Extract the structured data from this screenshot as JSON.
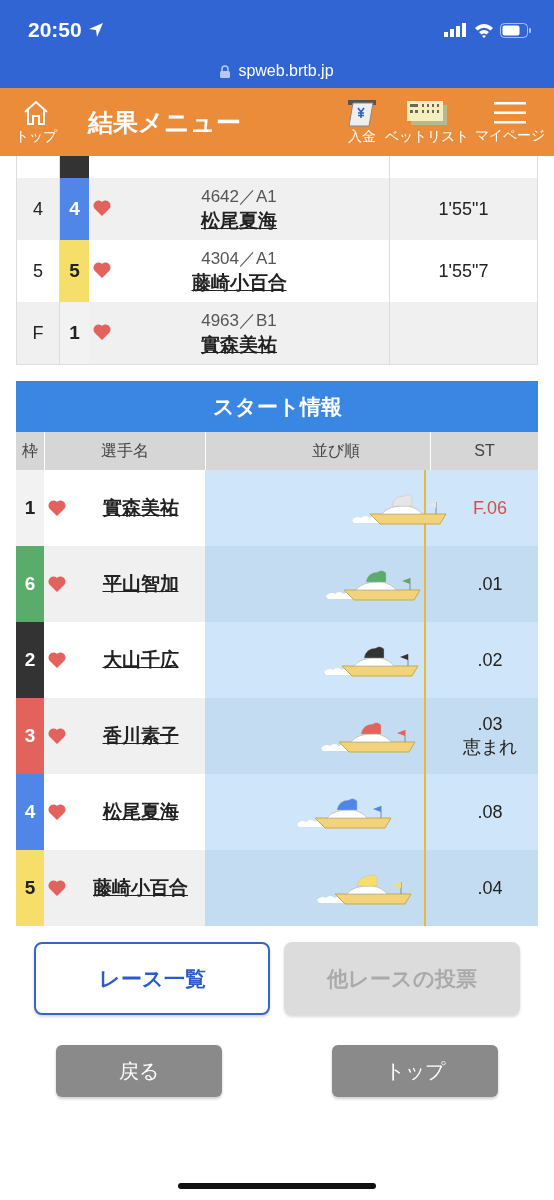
{
  "status_bar": {
    "time": "20:50",
    "url": "spweb.brtb.jp"
  },
  "header": {
    "home_label": "トップ",
    "title": "結果メニュー",
    "actions": [
      {
        "kind": "deposit",
        "label": "入金"
      },
      {
        "kind": "betlist",
        "label": "ベットリスト"
      },
      {
        "kind": "menu",
        "label": "マイページ"
      }
    ]
  },
  "results": {
    "partial_row": {
      "color": "#333333"
    },
    "rows": [
      {
        "rank": "4",
        "frame": "4",
        "color": "#4f86e8",
        "favorite": true,
        "id_class": "4642／A1",
        "name": "松尾夏海",
        "time": "1'55\"1"
      },
      {
        "rank": "5",
        "frame": "5",
        "color": "#f6de6a",
        "favorite": true,
        "id_class": "4304／A1",
        "name": "藤崎小百合",
        "time": "1'55\"7"
      },
      {
        "rank": "F",
        "frame": "1",
        "color": "#f2f2f2",
        "favorite": true,
        "id_class": "4963／B1",
        "name": "實森美祐"
      }
    ]
  },
  "start_info": {
    "title": "スタート情報",
    "columns": [
      "枠",
      "選手名",
      "並び順",
      "ST"
    ],
    "rows": [
      {
        "frame": "1",
        "color": "#f2f2f2",
        "favorite": true,
        "name": "實森美祐",
        "st": "F.06",
        "flying": true
      },
      {
        "frame": "6",
        "color": "#5aac6a",
        "favorite": true,
        "name": "平山智加",
        "st": ".01",
        "flying": false
      },
      {
        "frame": "2",
        "color": "#333333",
        "favorite": true,
        "name": "大山千広",
        "st": ".02",
        "flying": false
      },
      {
        "frame": "3",
        "color": "#e2625c",
        "favorite": true,
        "name": "香川素子",
        "st": ".03",
        "note": "恵まれ",
        "flying": false
      },
      {
        "frame": "4",
        "color": "#4f86e8",
        "favorite": true,
        "name": "松尾夏海",
        "st": ".08",
        "flying": false
      },
      {
        "frame": "5",
        "color": "#f6de6a",
        "favorite": true,
        "name": "藤崎小百合",
        "st": ".04",
        "flying": false
      }
    ]
  },
  "buttons": [
    {
      "label": "レース一覧",
      "disabled": false
    },
    {
      "label": "他レースの投票",
      "disabled": true
    }
  ],
  "nav_buttons": [
    "戻る",
    "トップ"
  ]
}
